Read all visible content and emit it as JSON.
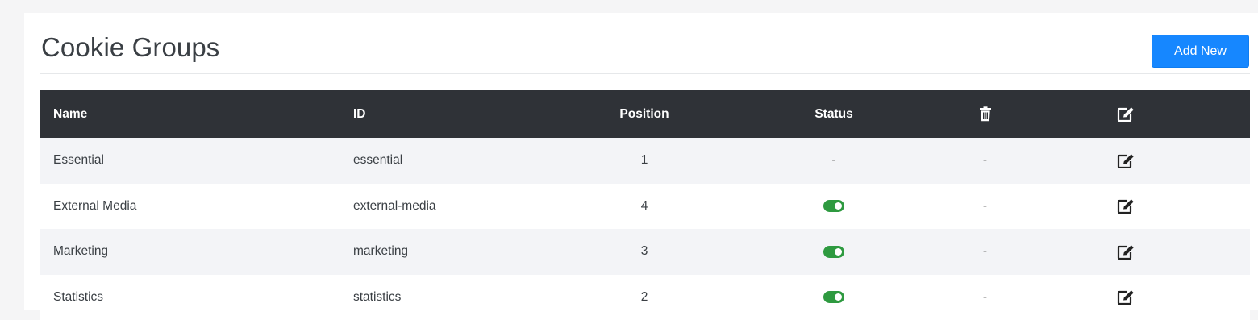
{
  "header": {
    "title": "Cookie Groups",
    "add_label": "Add New"
  },
  "colors": {
    "header_bg": "#2f3237",
    "accent": "#1687ff",
    "toggle_on": "#2e9a40",
    "row_striped": "#f3f4f7"
  },
  "table": {
    "columns": {
      "name": "Name",
      "id": "ID",
      "position": "Position",
      "status": "Status",
      "delete_icon": "trash-icon",
      "edit_icon": "edit-icon"
    },
    "rows": [
      {
        "name": "Essential",
        "id": "essential",
        "position": "1",
        "status": "-",
        "delete": "-",
        "status_toggle": false
      },
      {
        "name": "External Media",
        "id": "external-media",
        "position": "4",
        "status": "on",
        "delete": "-",
        "status_toggle": true
      },
      {
        "name": "Marketing",
        "id": "marketing",
        "position": "3",
        "status": "on",
        "delete": "-",
        "status_toggle": true
      },
      {
        "name": "Statistics",
        "id": "statistics",
        "position": "2",
        "status": "on",
        "delete": "-",
        "status_toggle": true
      }
    ]
  }
}
